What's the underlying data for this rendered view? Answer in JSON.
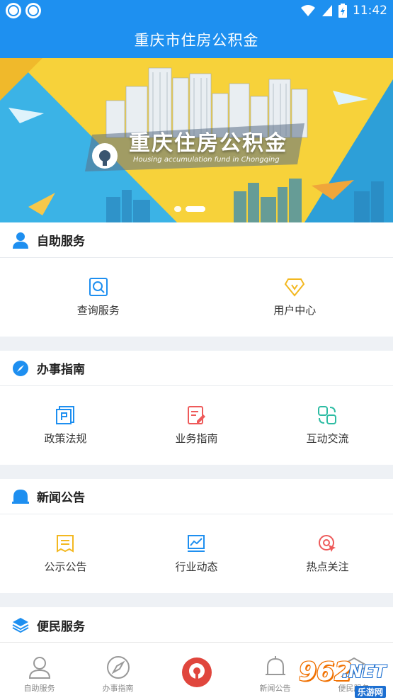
{
  "status_bar": {
    "time": "11:42"
  },
  "app_title": "重庆市住房公积金",
  "banner": {
    "title": "重庆住房公积金",
    "subtitle": "Housing accumulation fund in Chongqing",
    "slides": 2,
    "active_slide": 2
  },
  "sections": {
    "self_service": {
      "title": "自助服务",
      "items": [
        {
          "label": "查询服务",
          "icon": "search-doc-icon"
        },
        {
          "label": "用户中心",
          "icon": "diamond-icon"
        }
      ]
    },
    "guide": {
      "title": "办事指南",
      "items": [
        {
          "label": "政策法规",
          "icon": "policy-icon"
        },
        {
          "label": "业务指南",
          "icon": "edit-doc-icon"
        },
        {
          "label": "互动交流",
          "icon": "exchange-icon"
        }
      ]
    },
    "news": {
      "title": "新闻公告",
      "items": [
        {
          "label": "公示公告",
          "icon": "notice-icon"
        },
        {
          "label": "行业动态",
          "icon": "trend-chart-icon"
        },
        {
          "label": "热点关注",
          "icon": "target-icon"
        }
      ]
    },
    "convenience": {
      "title": "便民服务"
    }
  },
  "tabbar": {
    "tabs": [
      {
        "label": "自助服务",
        "icon": "person-icon"
      },
      {
        "label": "办事指南",
        "icon": "compass-icon"
      },
      {
        "label": "",
        "icon": "home-logo-icon"
      },
      {
        "label": "新闻公告",
        "icon": "bell-icon"
      },
      {
        "label": "便民服务",
        "icon": "layers-icon"
      }
    ]
  },
  "watermark": {
    "number": "962",
    "suffix": ".NET",
    "site": "乐游网"
  },
  "colors": {
    "primary": "#1e90f0",
    "banner_yellow": "#f7d23a",
    "home_red": "#e0463d"
  }
}
